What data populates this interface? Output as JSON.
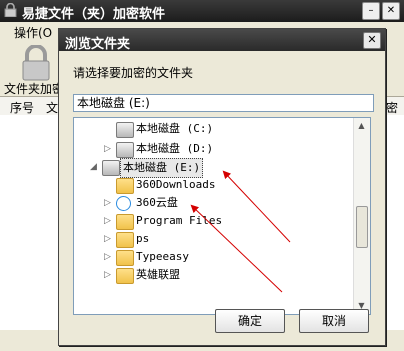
{
  "app": {
    "title": "易捷文件（夹）加密软件",
    "menu_operations": "操作(O",
    "toolbar_label": "文件夹加密",
    "columns": [
      "序号",
      "文",
      "密方式"
    ]
  },
  "dialog": {
    "title": "浏览文件夹",
    "prompt": "请选择要加密的文件夹",
    "path_value": "本地磁盘 (E:)",
    "ok_label": "确定",
    "cancel_label": "取消"
  },
  "tree": [
    {
      "label": "本地磁盘 (C:)",
      "type": "drive",
      "expander": "",
      "selected": false
    },
    {
      "label": "本地磁盘 (D:)",
      "type": "drive",
      "expander": "▷",
      "selected": false
    },
    {
      "label": "本地磁盘 (E:)",
      "type": "drive",
      "expander": "◢",
      "selected": true
    },
    {
      "label": "360Downloads",
      "type": "folder",
      "expander": "",
      "selected": false
    },
    {
      "label": "360云盘",
      "type": "cloud",
      "expander": "▷",
      "selected": false
    },
    {
      "label": "Program Files",
      "type": "folder",
      "expander": "▷",
      "selected": false
    },
    {
      "label": "ps",
      "type": "folder",
      "expander": "▷",
      "selected": false
    },
    {
      "label": "Typeeasy",
      "type": "folder",
      "expander": "▷",
      "selected": false
    },
    {
      "label": "英雄联盟",
      "type": "folder",
      "expander": "▷",
      "selected": false
    }
  ],
  "icons": {
    "lock": "lock-icon",
    "close": "close-icon",
    "minimize": "minimize-icon",
    "drive": "drive-icon",
    "folder": "folder-icon",
    "cloud": "cloud-icon"
  },
  "colors": {
    "titlebar": "#2a2a2a",
    "annotation_arrow": "#d40000",
    "folder": "#f1c24b"
  }
}
